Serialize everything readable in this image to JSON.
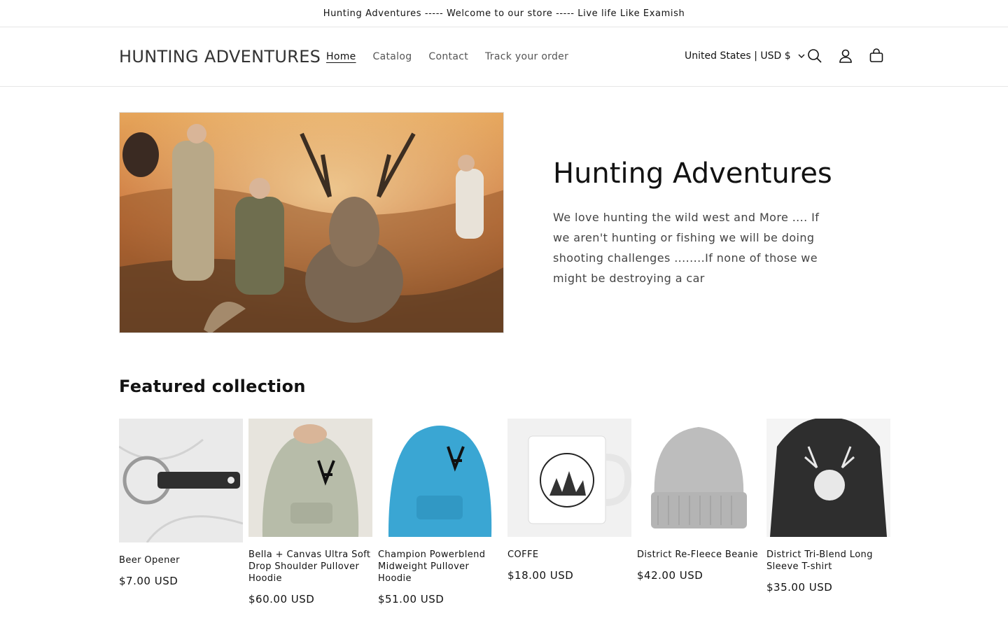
{
  "announcement": "Hunting Adventures ----- Welcome to our store ----- Live life Like Examish",
  "header": {
    "logo": "HUNTING ADVENTURES",
    "nav": [
      {
        "label": "Home",
        "active": true
      },
      {
        "label": "Catalog"
      },
      {
        "label": "Contact"
      },
      {
        "label": "Track your order"
      }
    ],
    "locale": "United States | USD $",
    "icons": [
      "search-icon",
      "account-icon",
      "cart-icon",
      "chevron-down-icon"
    ]
  },
  "hero": {
    "title": "Hunting Adventures",
    "description": "We love hunting the wild west and More .... If we aren't hunting or fishing we will be doing shooting challenges ........If none of those we might be destroying a car"
  },
  "featured": {
    "title": "Featured collection",
    "products": [
      {
        "name": "Beer Opener",
        "price": "$7.00 USD"
      },
      {
        "name": "Bella + Canvas Ultra Soft Drop Shoulder Pullover Hoodie",
        "price": "$60.00 USD"
      },
      {
        "name": "Champion Powerblend Midweight Pullover Hoodie",
        "price": "$51.00 USD"
      },
      {
        "name": "COFFE",
        "price": "$18.00 USD"
      },
      {
        "name": "District Re-Fleece Beanie",
        "price": "$42.00 USD"
      },
      {
        "name": "District Tri-Blend Long Sleeve T-shirt",
        "price": "$35.00 USD"
      }
    ]
  },
  "colors": {
    "text": "#121212",
    "border": "#e6e6e6",
    "hoodie_sage": "#b7bca9",
    "hoodie_blue": "#3aa6d3",
    "beanie_gray": "#b4b4b4",
    "shirt_dark": "#2e2e2e"
  }
}
